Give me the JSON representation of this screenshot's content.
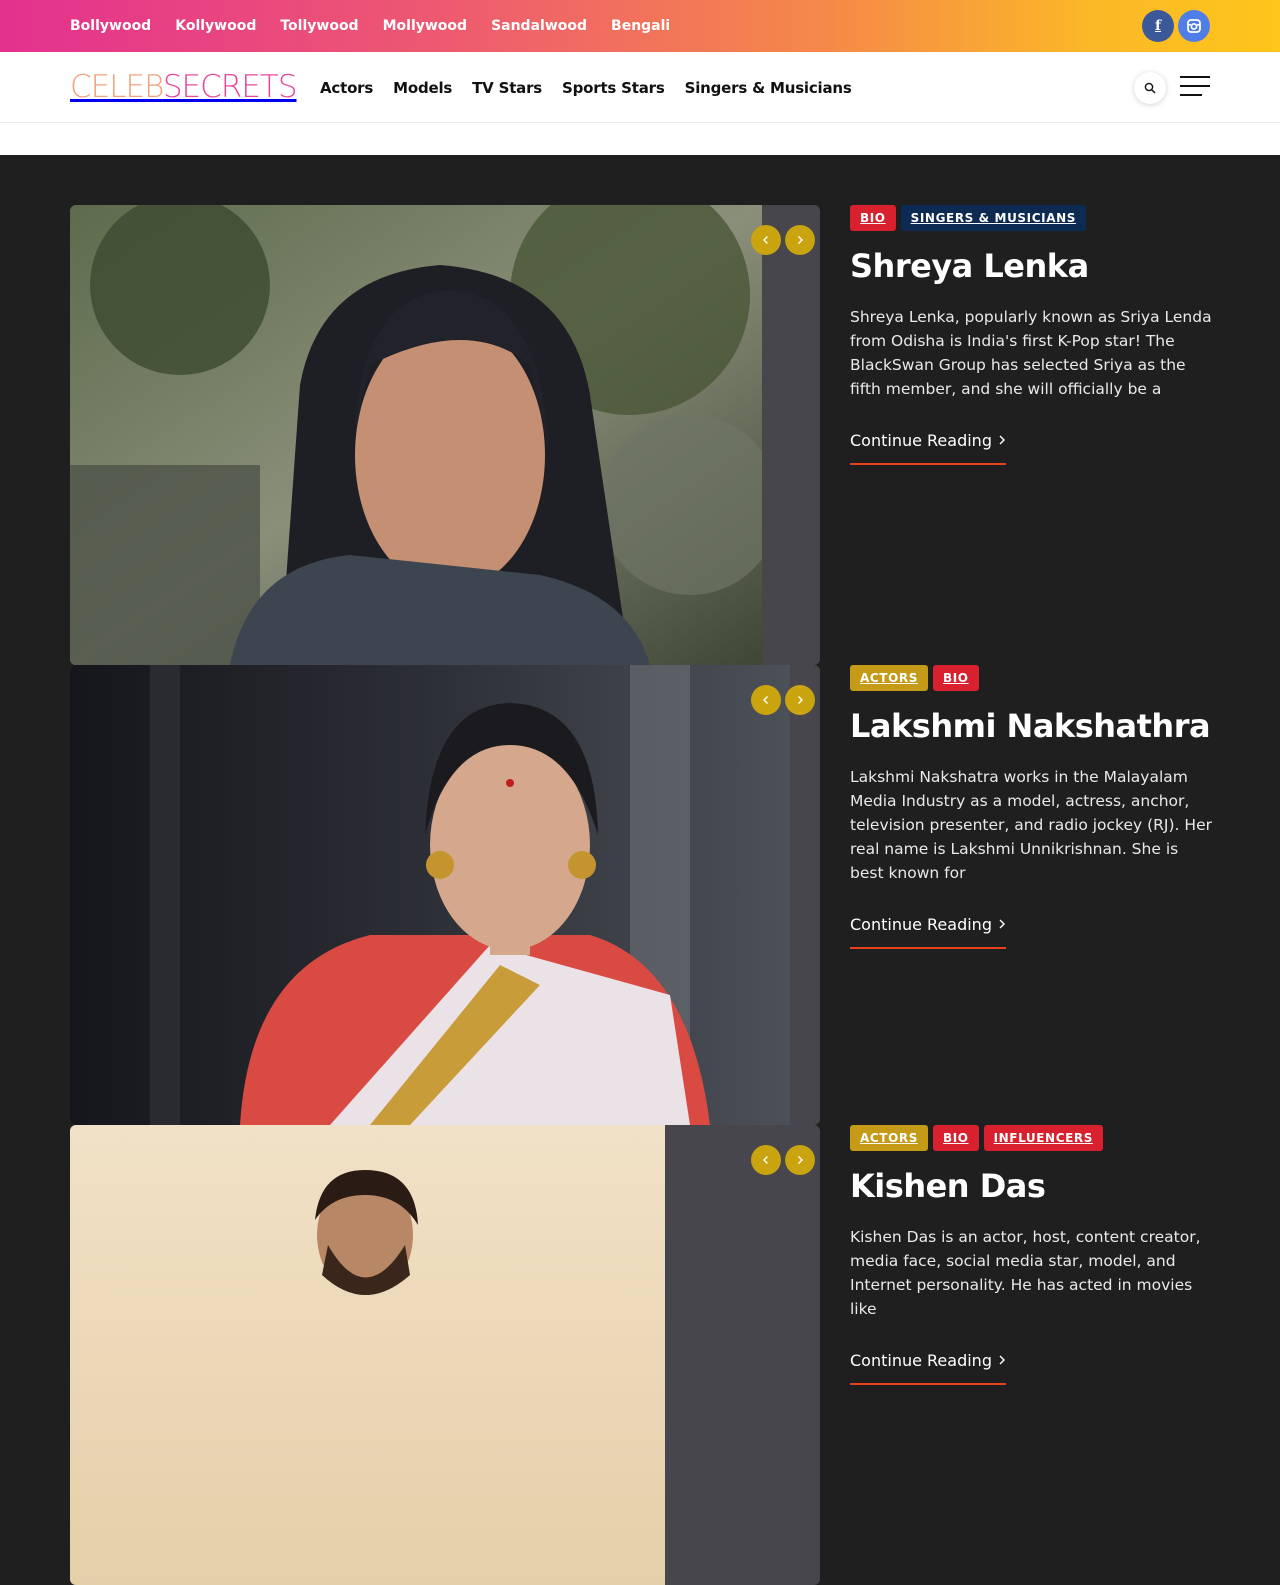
{
  "topbar": {
    "nav": [
      "Bollywood",
      "Kollywood",
      "Tollywood",
      "Mollywood",
      "Sandalwood",
      "Bengali"
    ],
    "social": [
      {
        "icon": "facebook-icon",
        "glyph": "f",
        "color": "#3b5998"
      },
      {
        "icon": "instagram-icon",
        "color": "#4f7ee8"
      }
    ]
  },
  "header": {
    "logo_part1": "CELEB",
    "logo_part2": "SECRETS",
    "nav": [
      "Actors",
      "Models",
      "TV Stars",
      "Sports Stars",
      "Singers & Musicians"
    ]
  },
  "colors": {
    "accent_gold": "#c9a40f",
    "tag_red": "#d9202f",
    "tag_navy": "#0c2a52",
    "tag_gold": "#c49a16",
    "underline": "#e8431c"
  },
  "posts": [
    {
      "tags": [
        {
          "label": "BIO",
          "color": "#d9202f"
        },
        {
          "label": "SINGERS & MUSICIANS",
          "color": "#0c2a52"
        }
      ],
      "title": "Shreya Lenka",
      "excerpt": "Shreya Lenka, popularly known as Sriya Lenda from Odisha is India's first K-Pop star! The BlackSwan Group has selected Sriya as the fifth member, and she will officially be a",
      "read_more": "Continue Reading"
    },
    {
      "tags": [
        {
          "label": "ACTORS",
          "color": "#c49a16"
        },
        {
          "label": "BIO",
          "color": "#d9202f"
        }
      ],
      "title": "Lakshmi Nakshathra",
      "excerpt": "Lakshmi Nakshatra works in the Malayalam Media Industry as a model, actress, anchor, television presenter, and radio jockey (RJ). Her real name is Lakshmi Unnikrishnan. She is best known for",
      "read_more": "Continue Reading"
    },
    {
      "tags": [
        {
          "label": "ACTORS",
          "color": "#c49a16"
        },
        {
          "label": "BIO",
          "color": "#d9202f"
        },
        {
          "label": "INFLUENCERS",
          "color": "#d9202f"
        }
      ],
      "title": "Kishen Das",
      "excerpt": "Kishen Das is an actor, host, content creator, media face, social media star, model, and Internet personality. He has acted in movies like",
      "read_more": "Continue Reading"
    }
  ]
}
